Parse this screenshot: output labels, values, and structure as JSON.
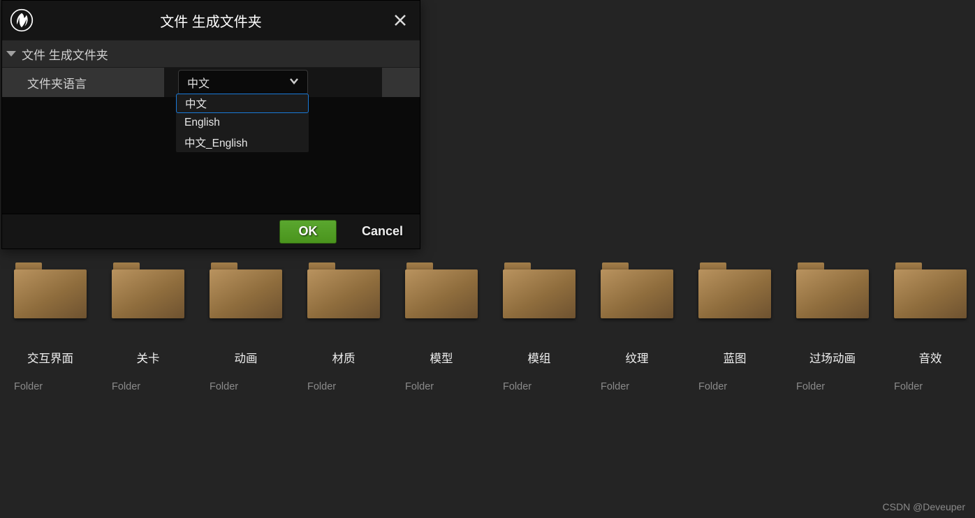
{
  "dialog": {
    "title": "文件 生成文件夹",
    "section_title": "文件 生成文件夹",
    "field_label": "文件夹语言",
    "selected": "中文",
    "options": [
      "中文",
      "English",
      "中文_English"
    ],
    "ok_label": "OK",
    "cancel_label": "Cancel"
  },
  "folders": [
    {
      "name": "交互界面",
      "type": "Folder"
    },
    {
      "name": "关卡",
      "type": "Folder"
    },
    {
      "name": "动画",
      "type": "Folder"
    },
    {
      "name": "材质",
      "type": "Folder"
    },
    {
      "name": "模型",
      "type": "Folder"
    },
    {
      "name": "模组",
      "type": "Folder"
    },
    {
      "name": "纹理",
      "type": "Folder"
    },
    {
      "name": "蓝图",
      "type": "Folder"
    },
    {
      "name": "过场动画",
      "type": "Folder"
    },
    {
      "name": "音效",
      "type": "Folder"
    }
  ],
  "watermark": "CSDN @Deveuper"
}
